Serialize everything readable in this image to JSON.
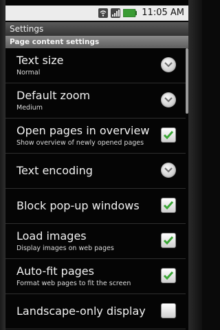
{
  "status": {
    "time": "11:05 AM"
  },
  "title": "Settings",
  "section": "Page content settings",
  "items": [
    {
      "title": "Text size",
      "summary": "Normal",
      "control": "chevron-down-icon"
    },
    {
      "title": "Default zoom",
      "summary": "Medium",
      "control": "chevron-down-icon"
    },
    {
      "title": "Open pages in overview",
      "summary": "Show overview of newly opened pages",
      "control": "checkbox",
      "checked": true
    },
    {
      "title": "Text encoding",
      "control": "chevron-down-icon"
    },
    {
      "title": "Block pop-up windows",
      "control": "checkbox",
      "checked": true
    },
    {
      "title": "Load images",
      "summary": "Display images on web pages",
      "control": "checkbox",
      "checked": true
    },
    {
      "title": "Auto-fit pages",
      "summary": "Format web pages to fit the screen",
      "control": "checkbox",
      "checked": true
    },
    {
      "title": "Landscape-only display",
      "control": "checkbox",
      "checked": false
    }
  ],
  "colors": {
    "check": "#3aa635",
    "chevron_arrow": "#707070"
  }
}
